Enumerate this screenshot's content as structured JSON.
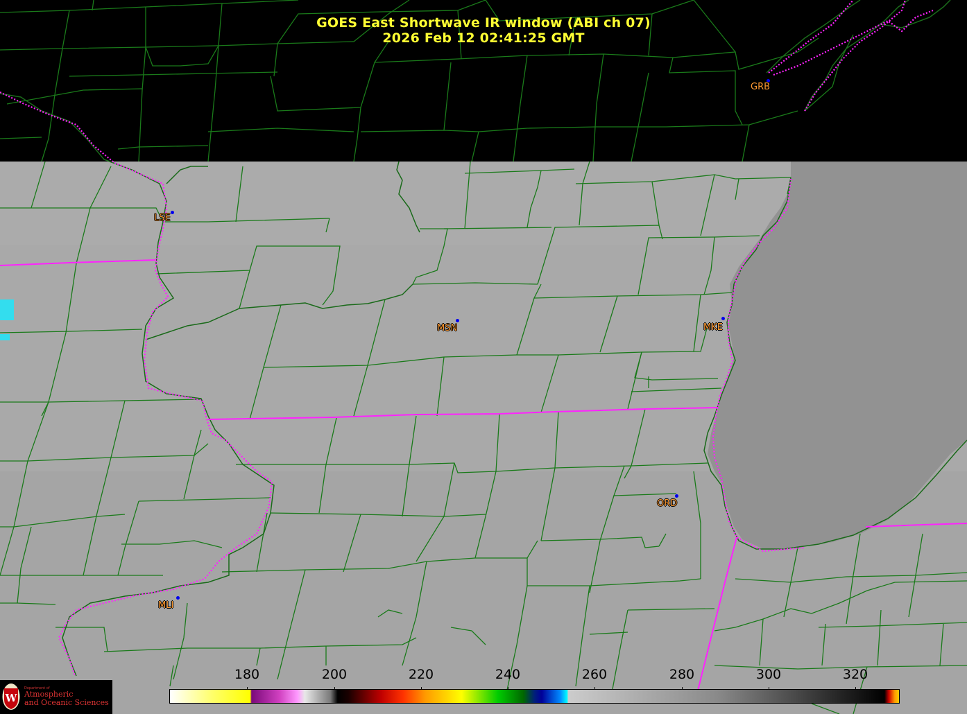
{
  "title": {
    "line1": "GOES East Shortwave IR window (ABI ch 07)",
    "line2": "2026 Feb 12  02:41:25 GMT"
  },
  "cities": [
    {
      "code": "GRB"
    },
    {
      "code": "LSE"
    },
    {
      "code": "MSN"
    },
    {
      "code": "MKE"
    },
    {
      "code": "ORD"
    },
    {
      "code": "MLI"
    }
  ],
  "colorbar": {
    "ticks": [
      "180",
      "200",
      "220",
      "240",
      "260",
      "280",
      "300",
      "320"
    ]
  },
  "logo": {
    "dept": "Department of",
    "line1": "Atmospheric",
    "line2": "and Oceanic Sciences"
  },
  "colors": {
    "title": "#ffff33",
    "county_lines": "#1a7a1a",
    "state_lines": "#ff22ff",
    "city_label": "#ff9a33",
    "city_dot": "#0000ee",
    "land_ir": "#a8a8a8",
    "lake_ir": "#909090"
  }
}
